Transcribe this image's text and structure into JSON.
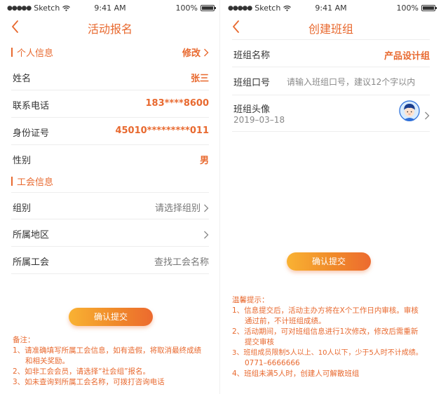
{
  "status_bar": {
    "carrier": "Sketch",
    "time": "9:41 AM",
    "battery": "100%"
  },
  "left": {
    "title": "活动报名",
    "personal_section": {
      "label": "个人信息",
      "action": "修改"
    },
    "fields": [
      {
        "label": "姓名",
        "value": "张三"
      },
      {
        "label": "联系电话",
        "value": "183****8600"
      },
      {
        "label": "身份证号",
        "value": "45010*********011"
      },
      {
        "label": "性别",
        "value": "男"
      }
    ],
    "union_section": {
      "label": "工会信息"
    },
    "union_fields": [
      {
        "label": "组别",
        "value": "请选择组别"
      },
      {
        "label": "所属地区",
        "value": ""
      },
      {
        "label": "所属工会",
        "placeholder": "查找工会名称"
      }
    ],
    "submit_label": "确认提交",
    "notes": {
      "title": "备注：",
      "lines": [
        "1、请准确填写所属工会信息，如有造假，将取消最终成绩",
        "和相关奖励。",
        "2、如非工会会员，请选择“社会组”报名。",
        "3、如未查询到所属工会名称，可拨打咨询电话"
      ]
    }
  },
  "right": {
    "title": "创建班组",
    "fields": {
      "name": {
        "label": "班组名称",
        "value": "产品设计组"
      },
      "slogan": {
        "label": "班组口号",
        "placeholder": "请输入班组口号，建议12个字以内"
      },
      "avatar": {
        "label": "班组头像",
        "date": "2019–03–18"
      }
    },
    "submit_label": "确认提交",
    "tips": {
      "title": "温馨提示：",
      "lines": [
        "1、信息提交后，活动主办方将在X个工作日内审核。审核",
        "通过前，不计班组成绩。",
        "2、活动期间，可对班组信息进行1次修改，修改后需重新",
        "提交审核",
        "3、班组成员限制5人以上、10人以下，少于5人时不计成绩。",
        "0771–6666666",
        "4、班组未满5人时，创建人可解散班组"
      ]
    }
  },
  "colors": {
    "accent": "#e8692f",
    "button_start": "#f9b233",
    "button_end": "#ec6a2f"
  }
}
